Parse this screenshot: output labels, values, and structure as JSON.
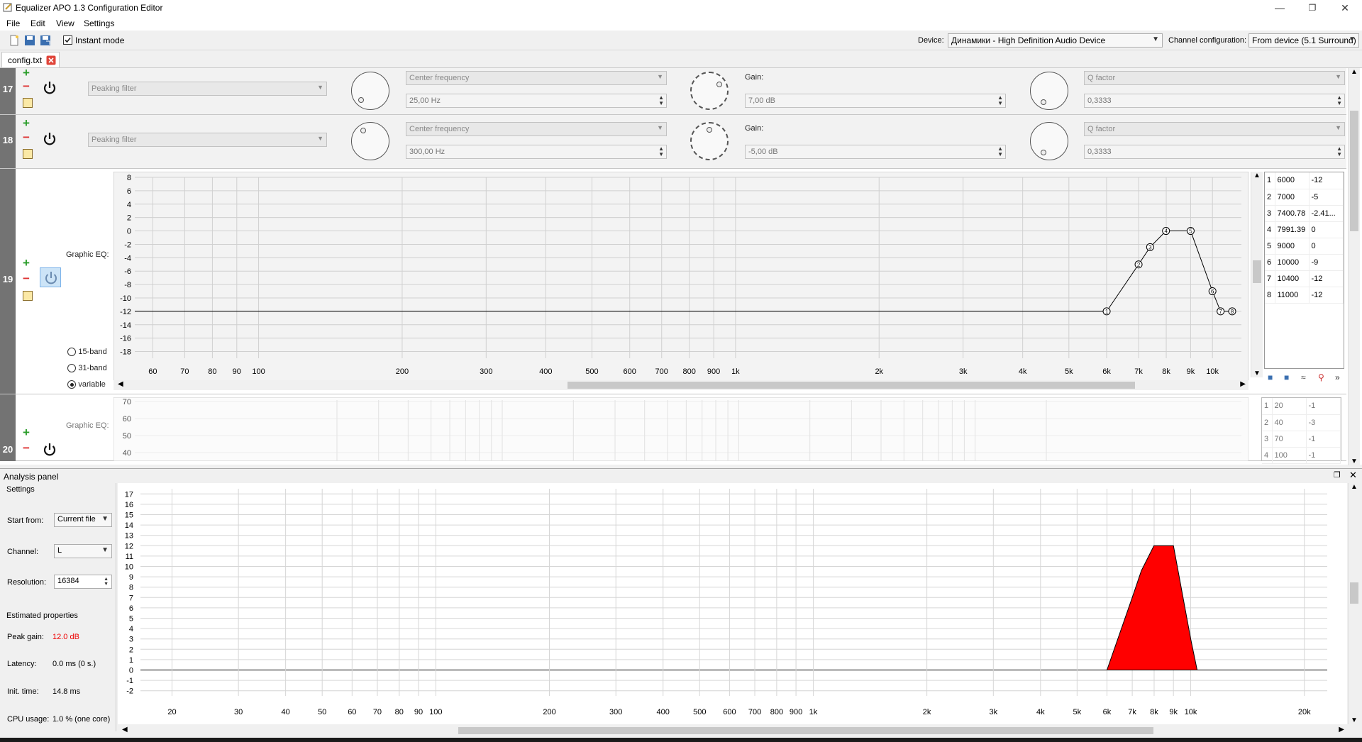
{
  "window": {
    "title": "Equalizer APO 1.3 Configuration Editor",
    "controls": {
      "minimize": "—",
      "restore": "❐",
      "close": "✕"
    }
  },
  "menu": [
    "File",
    "Edit",
    "View",
    "Settings"
  ],
  "toolbar": {
    "instant_mode_label": "Instant mode",
    "instant_mode_checked": true,
    "device_label": "Device:",
    "device_value": "Динамики - High Definition Audio Device",
    "channel_label": "Channel configuration:",
    "channel_value": "From device (5.1 Surround)"
  },
  "tab": {
    "label": "config.txt"
  },
  "filters": [
    {
      "number": "17",
      "type": "Peaking filter",
      "freq_mode": "Center frequency",
      "freq_value": "25,00 Hz",
      "gain_label": "Gain:",
      "gain_value": "7,00 dB",
      "q_mode": "Q factor",
      "q_value": "0,3333"
    },
    {
      "number": "18",
      "type": "Peaking filter",
      "freq_mode": "Center frequency",
      "freq_value": "300,00 Hz",
      "gain_label": "Gain:",
      "gain_value": "-5,00 dB",
      "q_mode": "Q factor",
      "q_value": "0,3333"
    }
  ],
  "geq19": {
    "number": "19",
    "label": "Graphic EQ:",
    "band_options": [
      "15-band",
      "31-band",
      "variable"
    ],
    "selected_band": "variable",
    "y_ticks": [
      "8",
      "6",
      "4",
      "2",
      "0",
      "-2",
      "-4",
      "-6",
      "-8",
      "-10",
      "-12",
      "-14",
      "-16",
      "-18"
    ],
    "x_ticks": [
      "60",
      "70",
      "80",
      "90",
      "100",
      "200",
      "300",
      "400",
      "500",
      "600",
      "700",
      "800",
      "900",
      "1k",
      "2k",
      "3k",
      "4k",
      "5k",
      "6k",
      "7k",
      "8k",
      "9k",
      "10k"
    ],
    "points": [
      {
        "n": "1",
        "freq": "6000",
        "gain": "-12"
      },
      {
        "n": "2",
        "freq": "7000",
        "gain": "-5"
      },
      {
        "n": "3",
        "freq": "7400.78",
        "gain": "-2.41..."
      },
      {
        "n": "4",
        "freq": "7991.39",
        "gain": "0"
      },
      {
        "n": "5",
        "freq": "9000",
        "gain": "0"
      },
      {
        "n": "6",
        "freq": "10000",
        "gain": "-9"
      },
      {
        "n": "7",
        "freq": "10400",
        "gain": "-12"
      },
      {
        "n": "8",
        "freq": "11000",
        "gain": "-12"
      }
    ]
  },
  "geq20": {
    "number": "20",
    "label": "Graphic EQ:",
    "y_ticks": [
      "70",
      "60",
      "50",
      "40"
    ],
    "points": [
      {
        "n": "1",
        "freq": "20",
        "gain": "-1"
      },
      {
        "n": "2",
        "freq": "40",
        "gain": "-3"
      },
      {
        "n": "3",
        "freq": "70",
        "gain": "-1"
      },
      {
        "n": "4",
        "freq": "100",
        "gain": "-1"
      }
    ]
  },
  "analysis": {
    "title": "Analysis panel",
    "settings_label": "Settings",
    "start_from_label": "Start from:",
    "start_from_value": "Current file",
    "channel_label": "Channel:",
    "channel_value": "L",
    "resolution_label": "Resolution:",
    "resolution_value": "16384",
    "estimated_label": "Estimated properties",
    "peak_gain_label": "Peak gain:",
    "peak_gain_value": "12.0 dB",
    "latency_label": "Latency:",
    "latency_value": "0.0 ms (0 s.)",
    "init_label": "Init. time:",
    "init_value": "14.8 ms",
    "cpu_label": "CPU usage:",
    "cpu_value": "1.0 % (one core)",
    "y_ticks": [
      "17",
      "16",
      "15",
      "14",
      "13",
      "12",
      "11",
      "10",
      "9",
      "8",
      "7",
      "6",
      "5",
      "4",
      "3",
      "2",
      "1",
      "0",
      "-1",
      "-2"
    ],
    "x_ticks": [
      "20",
      "30",
      "40",
      "50",
      "60",
      "70",
      "80",
      "90",
      "100",
      "200",
      "300",
      "400",
      "500",
      "600",
      "700",
      "800",
      "900",
      "1k",
      "2k",
      "3k",
      "4k",
      "5k",
      "6k",
      "7k",
      "8k",
      "9k",
      "10k",
      "20k"
    ],
    "fill_color": "#ff0000"
  }
}
